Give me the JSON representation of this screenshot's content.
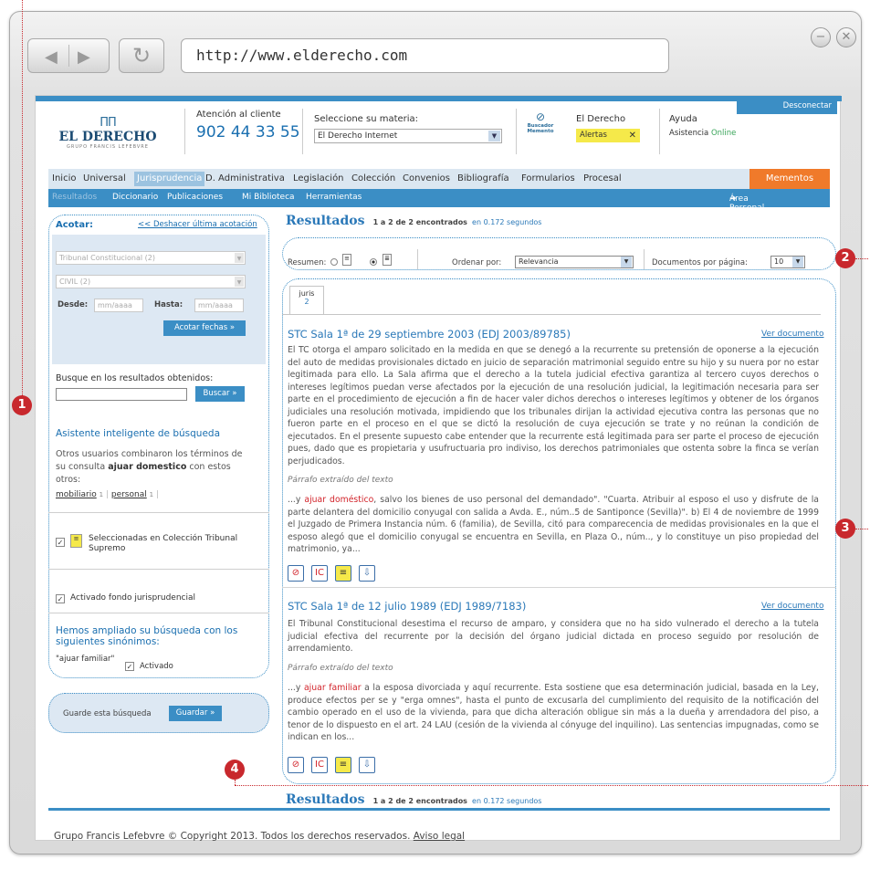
{
  "browser": {
    "url": "http://www.elderecho.com",
    "back_icon": "back-arrow-icon",
    "forward_icon": "forward-arrow-icon",
    "refresh_icon": "refresh-icon"
  },
  "header": {
    "logo_top": "EL DERECHO",
    "logo_sub": "GRUPO FRANCIS LEFEBVRE",
    "customer_label": "Atención al cliente",
    "customer_phone": "902 44 33 55",
    "subject_label": "Seleccione su materia:",
    "subject_value": "El Derecho Internet",
    "search_memento_l1": "Buscador",
    "search_memento_l2": "Memento",
    "elderecho_label": "El Derecho",
    "alerts_label": "Alertas",
    "help_label": "Ayuda",
    "online_label": "Asistencia",
    "online_status": "Online",
    "disconnect_label": "Desconectar"
  },
  "menu": {
    "items": [
      "Inicio",
      "Universal",
      "Jurisprudencia",
      "D. Administrativa",
      "Legislación",
      "Colección",
      "Convenios",
      "Bibliografía",
      "Formularios",
      "Procesal"
    ],
    "mementos": "Mementos",
    "submenu": [
      "Resultados",
      "Diccionario",
      "Publicaciones",
      "Mi Biblioteca",
      "Herramientas"
    ],
    "area_personal": "Área Personal"
  },
  "sidebar": {
    "acotar_label": "Acotar:",
    "undo_link": "<< Deshacer última acotación",
    "court_select": "Tribunal Constitucional (2)",
    "jurisdiction_select": "CIVIL (2)",
    "from_label": "Desde:",
    "to_label": "Hasta:",
    "date_placeholder": "mm/aaaa",
    "date_button": "Acotar fechas »",
    "search_in_label": "Busque en los resultados obtenidos:",
    "search_button": "Buscar »",
    "assistant_title": "Asistente inteligente de búsqueda",
    "assistant_text_1": "Otros usuarios combinaron los términos de",
    "assistant_text_2a": "su consulta ",
    "assistant_text_bold": "ajuar domestico",
    "assistant_text_2b": " con estos",
    "assistant_text_3": "otros:",
    "term1": "mobiliario",
    "term1_count": "1",
    "term2": "personal",
    "term2_count": "1",
    "selected_label_1": "Seleccionadas en Colección Tribunal",
    "selected_label_2": "Supremo",
    "fund_label": "Activado fondo jurisprudencial",
    "expanded_title_1": "Hemos ampliado su búsqueda con los",
    "expanded_title_2": "siguientes sinónimos:",
    "synonym": "\"ajuar familiar\"",
    "synonym_active": "Activado",
    "save_label": "Guarde esta búsqueda",
    "save_button": "Guardar »"
  },
  "results": {
    "title": "Resultados",
    "summary": "1 a 2 de 2 encontrados",
    "time": "en 0.172 segundos",
    "resumen_label": "Resumen:",
    "order_label": "Ordenar por:",
    "order_value": "Relevancia",
    "perpage_label": "Documentos por página:",
    "perpage_value": "10",
    "tab_label": "juris",
    "tab_count": "2",
    "view_doc": "Ver documento",
    "excerpt_label": "Párrafo extraído del texto",
    "items": [
      {
        "title": "STC Sala 1ª de 29 septiembre 2003 (EDJ 2003/89785)",
        "summary": "El TC otorga el amparo solicitado en la medida en que se denegó a la recurrente su pretensión de oponerse a la ejecución del auto de medidas provisionales dictado en juicio de separación matrimonial seguido entre su hijo y su nuera por no estar legitimada para ello. La Sala afirma que el derecho a la tutela judicial efectiva garantiza al tercero cuyos derechos o intereses legítimos puedan verse afectados por la ejecución de una resolución judicial, la legitimación necesaria para ser parte en el procedimiento de ejecución a fin de hacer valer dichos derechos o intereses legítimos y obtener de los órganos judiciales una resolución motivada, impidiendo que los tribunales dirijan la actividad ejecutiva contra las personas que no fueron parte en el proceso en el que se dictó la resolución de cuya ejecución se trate y no reúnan la condición de ejecutados. En el presente supuesto cabe entender que la recurrente está legitimada para ser parte el proceso de ejecución pues, dado que es propietaria y usufructuaria pro indiviso, los derechos patrimoniales que ostenta sobre la finca se verían perjudicados.",
        "excerpt_pre": "...y ",
        "excerpt_hl": "ajuar doméstico",
        "excerpt_post": ", salvo los bienes de uso personal del demandado\". \"Cuarta. Atribuir al esposo el uso y disfrute de la parte delantera del domicilio conyugal con salida a Avda. E., núm..5 de Santiponce (Sevilla)\". b) El 4 de noviembre de 1999 el Juzgado de Primera Instancia núm. 6 (familia), de Sevilla, citó para comparecencia de medidas provisionales en la que el esposo alegó que el domicilio conyugal se encuentra en Sevilla, en Plaza O., núm.., y lo constituye un piso propiedad del matrimonio, ya..."
      },
      {
        "title": "STC Sala 1ª de 12 julio 1989 (EDJ 1989/7183)",
        "summary": "El Tribunal Constitucional desestima el recurso de amparo, y considera que no ha sido vulnerado el derecho a la tutela judicial efectiva del recurrente por la decisión del órgano judicial dictada en proceso seguido por resolución de arrendamiento.",
        "excerpt_pre": "...y ",
        "excerpt_hl": "ajuar familiar",
        "excerpt_post": " a la esposa divorciada y aquí recurrente. Esta sostiene que esa determinación judicial, basada en la Ley, produce efectos per se y \"erga omnes\", hasta el punto de excusarla del cumplimiento del requisito de la notificación del cambio operado en el uso de la vivienda, para que dicha alteración obligue sin más a la dueña y arrendadora del piso, a tenor de lo dispuesto en el art. 24 LAU (cesión de la vivienda al cónyuge del inquilino). Las sentencias impugnadas, como se indican en los..."
      }
    ]
  },
  "markers": [
    "1",
    "2",
    "3",
    "4"
  ],
  "footer": {
    "text": "Grupo Francis Lefebvre © Copyright 2013. Todos los derechos reservados.",
    "legal": "Aviso legal"
  },
  "colors": {
    "accent": "#3b8ec5",
    "marker": "#c8282d",
    "mementos": "#f07a2a",
    "alert": "#f5e94a"
  }
}
